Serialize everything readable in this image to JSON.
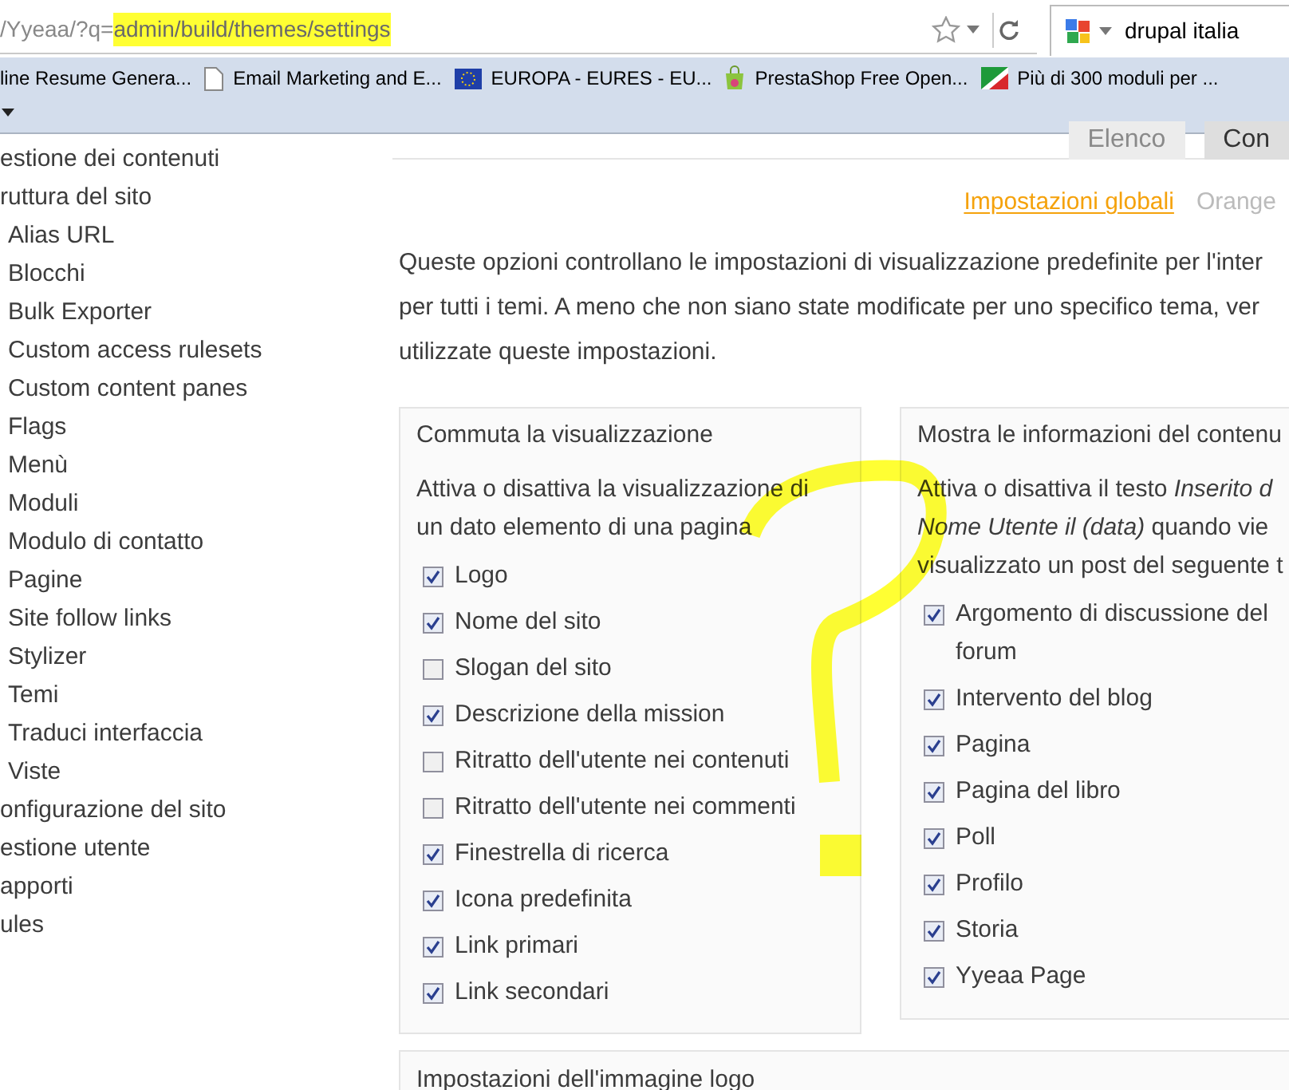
{
  "address_bar": {
    "prefix": "/Yyeaa/?q=",
    "highlighted": "admin/build/themes/settings"
  },
  "search_box": {
    "value": "drupal italia"
  },
  "bookmarks": [
    {
      "label": "line Resume Genera...",
      "kind": "none"
    },
    {
      "label": "Email Marketing and E...",
      "kind": "page"
    },
    {
      "label": "EUROPA - EURES - EU...",
      "kind": "eu"
    },
    {
      "label": "PrestaShop Free Open...",
      "kind": "bag"
    },
    {
      "label": "Più di 300 moduli per ...",
      "kind": "flag"
    }
  ],
  "sidebar": [
    {
      "label": "estione dei contenuti"
    },
    {
      "label": "ruttura del sito",
      "children": [
        {
          "label": "Alias URL"
        },
        {
          "label": "Blocchi"
        },
        {
          "label": "Bulk Exporter"
        },
        {
          "label": "Custom access rulesets"
        },
        {
          "label": "Custom content panes"
        },
        {
          "label": "Flags"
        },
        {
          "label": "Menù"
        },
        {
          "label": "Moduli"
        },
        {
          "label": "Modulo di contatto"
        },
        {
          "label": "Pagine"
        },
        {
          "label": "Site follow links"
        },
        {
          "label": "Stylizer"
        },
        {
          "label": "Temi"
        },
        {
          "label": "Traduci interfaccia"
        },
        {
          "label": "Viste"
        }
      ]
    },
    {
      "label": "onfigurazione del sito"
    },
    {
      "label": "estione utente"
    },
    {
      "label": "apporti"
    },
    {
      "label": "ules"
    }
  ],
  "tabs": [
    {
      "label": "Elenco",
      "selected": false
    },
    {
      "label": "Con",
      "selected": true
    }
  ],
  "subtabs": [
    {
      "label": "Impostazioni globali",
      "selected": true
    },
    {
      "label": "Orange",
      "selected": false
    }
  ],
  "description": "Queste opzioni controllano le impostazioni di visualizzazione predefinite per l'inter\nper tutti i temi. A meno che non siano state modificate per uno specifico tema, ver\nutilizzate queste impostazioni.",
  "fieldsets": [
    {
      "legend": "Commuta la visualizzazione",
      "description": "Attiva o disattiva la visualizzazione di\nun dato elemento di una pagina",
      "options": [
        {
          "label": "Logo",
          "checked": true
        },
        {
          "label": "Nome del sito",
          "checked": true
        },
        {
          "label": "Slogan del sito",
          "checked": false
        },
        {
          "label": "Descrizione della mission",
          "checked": true
        },
        {
          "label": "Ritratto dell'utente nei contenuti",
          "checked": false
        },
        {
          "label": "Ritratto dell'utente nei commenti",
          "checked": false
        },
        {
          "label": "Finestrella di ricerca",
          "checked": true
        },
        {
          "label": "Icona predefinita",
          "checked": true
        },
        {
          "label": "Link primari",
          "checked": true
        },
        {
          "label": "Link secondari",
          "checked": true
        }
      ]
    },
    {
      "legend": "Mostra le informazioni del contenu",
      "description": "Attiva o disattiva il testo *Inserito d*\n*Nome Utente il (data)* quando vie\nvisualizzato un post del seguente t",
      "options": [
        {
          "label": "Argomento di discussione del\nforum",
          "checked": true
        },
        {
          "label": "Intervento del blog",
          "checked": true
        },
        {
          "label": "Pagina",
          "checked": true
        },
        {
          "label": "Pagina del libro",
          "checked": true
        },
        {
          "label": "Poll",
          "checked": true
        },
        {
          "label": "Profilo",
          "checked": true
        },
        {
          "label": "Storia",
          "checked": true
        },
        {
          "label": "Yyeaa Page",
          "checked": true
        }
      ]
    }
  ],
  "next_fieldset": {
    "legend": "Impostazioni dell'immagine logo"
  }
}
